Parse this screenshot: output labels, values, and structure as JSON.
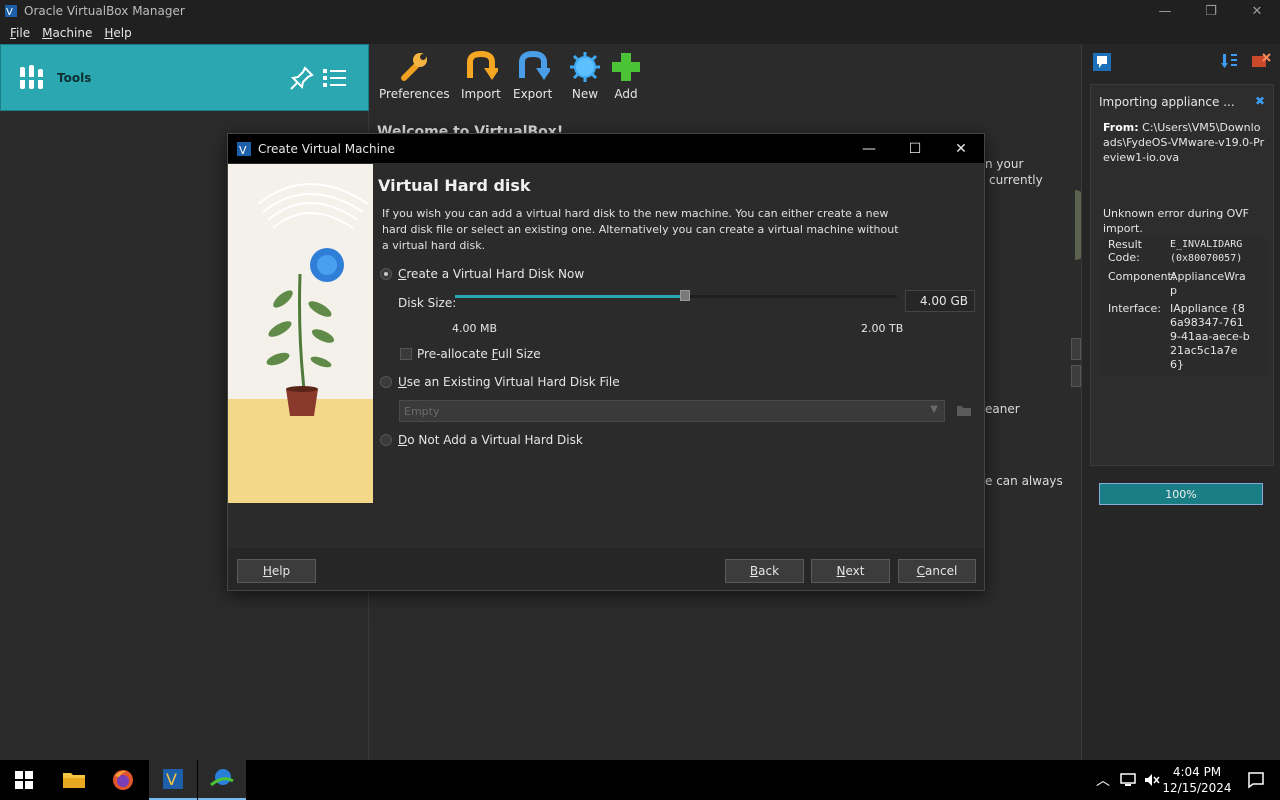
{
  "window": {
    "title": "Oracle VirtualBox Manager",
    "minimize": "—",
    "restore": "❐",
    "close": "✕"
  },
  "menu": {
    "items": [
      {
        "label": "File",
        "mnemonic": "F",
        "rest": "ile"
      },
      {
        "label": "Machine",
        "mnemonic": "M",
        "rest": "achine"
      },
      {
        "label": "Help",
        "mnemonic": "H",
        "rest": "elp"
      }
    ]
  },
  "sidebar": {
    "tools_label": "Tools"
  },
  "toolbar": {
    "preferences": "Preferences",
    "import": "Import",
    "export": "Export",
    "new": "New",
    "add": "Add"
  },
  "background": {
    "welcome_title": "Welcome to VirtualBox!",
    "text_your": "n your",
    "text_currently": "currently",
    "text_eaner": "eaner",
    "text_always": "e can always"
  },
  "notification": {
    "title": "Importing appliance ...",
    "close": "✖",
    "from_label": "From:",
    "from_path": "C:\\Users\\VM5\\Downloads\\FydeOS-VMware-v19.0-Preview1-io.ova",
    "error": "Unknown error during OVF import.",
    "result_code_label": "Result Code:",
    "result_code_value": "E_INVALIDARG (0x80070057)",
    "component_label": "Component:",
    "component_value": "ApplianceWrap",
    "interface_label": "Interface:",
    "interface_value": "IAppliance {86a98347-7619-41aa-aece-b21ac5c1a7e6}",
    "progress_percent": 100,
    "progress_text": "100%"
  },
  "dialog": {
    "title": "Create Virtual Machine",
    "minimize": "—",
    "maximize": "☐",
    "close": "✕",
    "heading": "Virtual Hard disk",
    "description": "If you wish you can add a virtual hard disk to the new machine. You can either create a new hard disk file or select an existing one. Alternatively you can create a virtual machine without a virtual hard disk.",
    "option_create": {
      "before": "",
      "mnemonic": "C",
      "after": "reate a Virtual Hard Disk Now"
    },
    "disk_size_label": "Disk Size:",
    "disk_size_value": "4.00 GB",
    "slider_position": 0.52,
    "min_label": "4.00 MB",
    "max_label": "2.00 TB",
    "preallocate": {
      "before": "Pre-allocate ",
      "mnemonic": "F",
      "after": "ull Size"
    },
    "option_existing": {
      "before": "",
      "mnemonic": "U",
      "after": "se an Existing Virtual Hard Disk File"
    },
    "existing_combo": "Empty",
    "option_none": {
      "before": "",
      "mnemonic": "D",
      "after": "o Not Add a Virtual Hard Disk"
    },
    "buttons": {
      "help": {
        "mnemonic": "H",
        "after": "elp"
      },
      "back": {
        "mnemonic": "B",
        "after": "ack"
      },
      "next": {
        "mnemonic": "N",
        "after": "ext"
      },
      "cancel": {
        "mnemonic": "C",
        "after": "ancel"
      }
    }
  },
  "taskbar": {
    "time": "4:04 PM",
    "date": "12/15/2024"
  },
  "colors": {
    "accent": "#2aa7b0",
    "progress": "#1a7f85"
  }
}
